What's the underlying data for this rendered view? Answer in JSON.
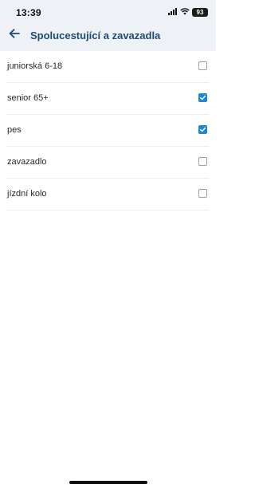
{
  "status_bar": {
    "time": "13:39",
    "battery": "93",
    "icons": [
      "signal-icon",
      "wifi-icon",
      "battery-icon"
    ]
  },
  "header": {
    "back_icon": "arrow-left-icon",
    "title": "Spolucestující a zavazadla"
  },
  "options": [
    {
      "label": "juniorská 6-18",
      "checked": false
    },
    {
      "label": "senior 65+",
      "checked": true
    },
    {
      "label": "pes",
      "checked": true
    },
    {
      "label": "zavazadlo",
      "checked": false
    },
    {
      "label": "jízdní kolo",
      "checked": false
    }
  ],
  "colors": {
    "header_bg": "#eef1f5",
    "title": "#1d4a78",
    "checkbox_checked": "#1e88d6"
  }
}
